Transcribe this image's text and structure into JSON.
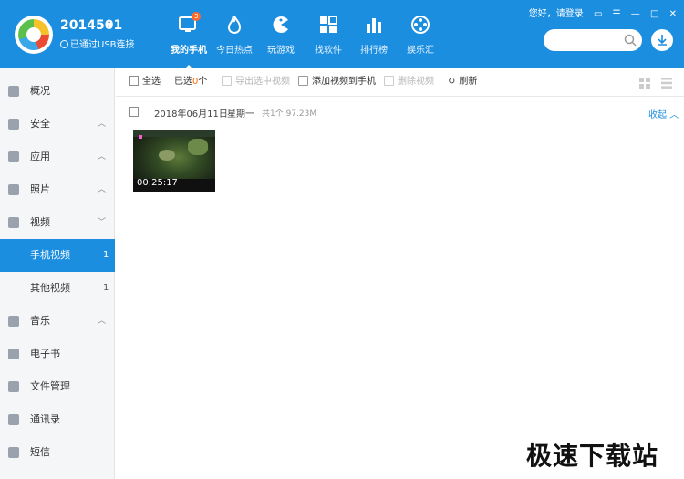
{
  "header": {
    "device_name": "2014501",
    "usb_status": "已通过USB连接",
    "login_text": "您好，请登录",
    "nav": [
      {
        "label": "我的手机",
        "badge": "3"
      },
      {
        "label": "今日热点"
      },
      {
        "label": "玩游戏"
      },
      {
        "label": "找软件"
      },
      {
        "label": "排行榜"
      },
      {
        "label": "娱乐汇"
      }
    ]
  },
  "sidebar": {
    "items": [
      {
        "label": "概况"
      },
      {
        "label": "安全"
      },
      {
        "label": "应用"
      },
      {
        "label": "照片"
      },
      {
        "label": "视频"
      },
      {
        "label": "手机视频",
        "count": "1"
      },
      {
        "label": "其他视频",
        "count": "1"
      },
      {
        "label": "音乐"
      },
      {
        "label": "电子书"
      },
      {
        "label": "文件管理"
      },
      {
        "label": "通讯录"
      },
      {
        "label": "短信"
      }
    ]
  },
  "toolbar": {
    "select_all": "全选",
    "selected_prefix": "已选",
    "selected_count": "0",
    "selected_suffix": "个",
    "export": "导出选中视频",
    "add": "添加视频到手机",
    "delete": "删除视频",
    "refresh": "刷新"
  },
  "group": {
    "date": "2018年06月11日",
    "weekday": "星期一",
    "summary": "共1个 97.23M",
    "collapse": "收起"
  },
  "video": {
    "duration": "00:25:17"
  },
  "watermark": "极速下载站",
  "colors": {
    "accent": "#1b8ee0",
    "selected_count": "#ff6a00"
  }
}
